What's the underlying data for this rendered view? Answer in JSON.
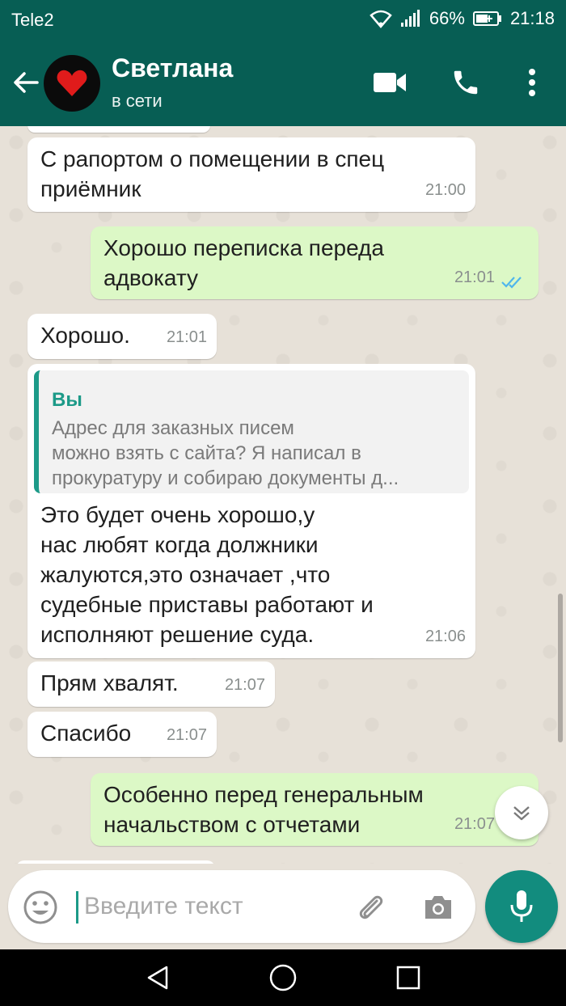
{
  "status_bar": {
    "carrier": "Tele2",
    "battery": "66%",
    "time": "21:18"
  },
  "header": {
    "contact_name": "Светлана",
    "status": "в сети"
  },
  "messages": [
    {
      "dir": "in",
      "lines": [
        "С рапортом о помещении в спец",
        "приёмник"
      ],
      "time": "21:00"
    },
    {
      "dir": "out",
      "lines": [
        "Хорошо переписка передa",
        "адвокату"
      ],
      "time": "21:01",
      "read": true
    },
    {
      "dir": "in",
      "lines": [
        "Хорошо."
      ],
      "time": "21:01"
    },
    {
      "dir": "in",
      "quote": {
        "author": "Вы",
        "lines": [
          "Адрес для заказных писем",
          "можно взять с сайта? Я написал в",
          "прокуратуру и собираю документы д..."
        ]
      },
      "lines": [
        "Это будет очень хорошо,у",
        "нас любят когда должники",
        "жалуются,это означает ,что",
        "судебные приставы работают и",
        "исполняют решение суда."
      ],
      "time": "21:06"
    },
    {
      "dir": "in",
      "lines": [
        "Прям хвалят."
      ],
      "time": "21:07"
    },
    {
      "dir": "in",
      "lines": [
        "Спасибо"
      ],
      "time": "21:07"
    },
    {
      "dir": "out",
      "lines": [
        "Особенно перед генеральным",
        "начальством с отчетами"
      ],
      "time": "21:07",
      "read": true
    }
  ],
  "input": {
    "placeholder": "Введите текст"
  },
  "colors": {
    "header": "#075e54",
    "outgoing": "#dcf8c6",
    "incoming": "#ffffff",
    "accent": "#128c7e",
    "read_ticks": "#4fb6ec"
  },
  "icons": [
    "back-arrow-icon",
    "heart-icon",
    "video-call-icon",
    "phone-icon",
    "more-vert-icon",
    "double-check-icon",
    "chevron-down-icon",
    "emoji-icon",
    "attach-icon",
    "camera-icon",
    "mic-icon",
    "nav-back-icon",
    "nav-home-icon",
    "nav-recents-icon"
  ]
}
